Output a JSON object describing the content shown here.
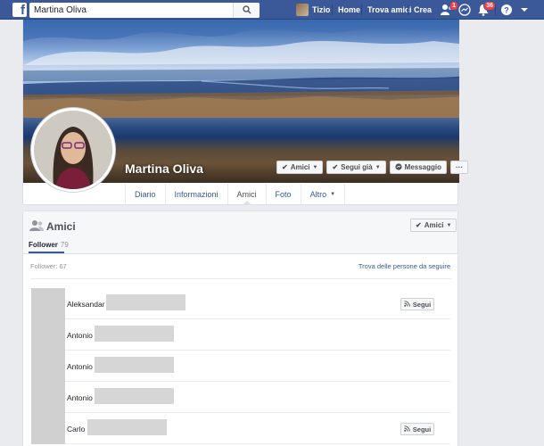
{
  "topbar": {
    "search_value": "Martina Oliva",
    "user_name": "Tizio",
    "nav_links": [
      "Home",
      "Trova amici",
      "Crea"
    ],
    "friend_requests_badge": "1",
    "notifications_badge": "36",
    "bar_color": "#3b5998"
  },
  "profile": {
    "name": "Martina Oliva",
    "buttons": {
      "friends": "Amici",
      "following": "Segui già",
      "message": "Messaggio",
      "more": "···"
    },
    "tabs": [
      "Diario",
      "Informazioni",
      "Amici",
      "Foto",
      "Altro"
    ]
  },
  "friends": {
    "title": "Amici",
    "header_button": "Amici",
    "tab_label": "Follower",
    "tab_count": "79",
    "subtitle": "Follower: 67",
    "find_link": "Trova delle persone da seguire",
    "follow_label": "Segui",
    "rows": [
      {
        "name": "Aleksandar",
        "show_follow": true
      },
      {
        "name": "Antonio",
        "show_follow": false
      },
      {
        "name": "Antonio",
        "show_follow": false
      },
      {
        "name": "Antonio",
        "show_follow": false
      },
      {
        "name": "Carlo",
        "show_follow": true
      }
    ]
  }
}
